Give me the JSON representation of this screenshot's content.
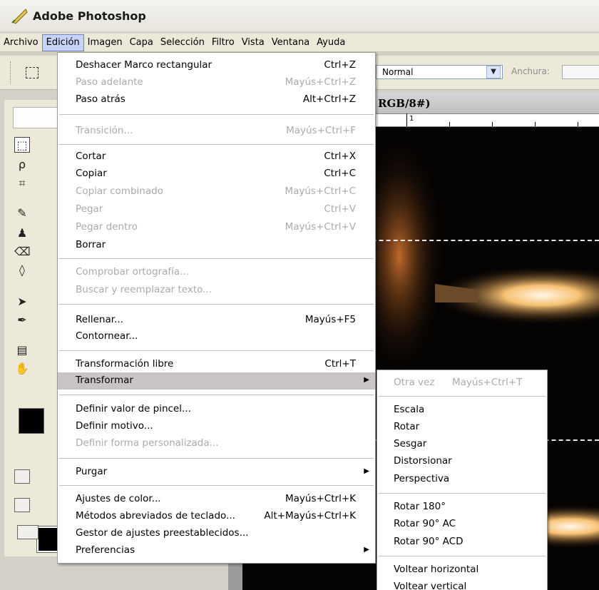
{
  "app": {
    "title": "Adobe Photoshop"
  },
  "menubar": {
    "items": [
      "Archivo",
      "Edición",
      "Imagen",
      "Capa",
      "Selección",
      "Filtro",
      "Vista",
      "Ventana",
      "Ayuda"
    ],
    "active": "Edición"
  },
  "options": {
    "mode_value": "Normal",
    "width_label": "Anchura:"
  },
  "document": {
    "title_fragment": "RGB/8#)",
    "ruler_label": "1"
  },
  "edit_menu": {
    "items": [
      {
        "label": "Deshacer Marco rectangular",
        "shortcut": "Ctrl+Z",
        "enabled": true
      },
      {
        "label": "Paso adelante",
        "shortcut": "Mayús+Ctrl+Z",
        "enabled": false
      },
      {
        "label": "Paso atrás",
        "shortcut": "Alt+Ctrl+Z",
        "enabled": true
      },
      {
        "label": "Transición...",
        "shortcut": "Mayús+Ctrl+F",
        "enabled": false
      },
      {
        "label": "Cortar",
        "shortcut": "Ctrl+X",
        "enabled": true
      },
      {
        "label": "Copiar",
        "shortcut": "Ctrl+C",
        "enabled": true
      },
      {
        "label": "Copiar combinado",
        "shortcut": "Mayús+Ctrl+C",
        "enabled": false
      },
      {
        "label": "Pegar",
        "shortcut": "Ctrl+V",
        "enabled": false
      },
      {
        "label": "Pegar dentro",
        "shortcut": "Mayús+Ctrl+V",
        "enabled": false
      },
      {
        "label": "Borrar",
        "shortcut": "",
        "enabled": true
      },
      {
        "label": "Comprobar ortografía...",
        "shortcut": "",
        "enabled": false
      },
      {
        "label": "Buscar y reemplazar texto...",
        "shortcut": "",
        "enabled": false
      },
      {
        "label": "Rellenar...",
        "shortcut": "Mayús+F5",
        "enabled": true
      },
      {
        "label": "Contornear...",
        "shortcut": "",
        "enabled": true
      },
      {
        "label": "Transformación libre",
        "shortcut": "Ctrl+T",
        "enabled": true
      },
      {
        "label": "Transformar",
        "shortcut": "",
        "enabled": true,
        "submenu": true,
        "highlighted": true
      },
      {
        "label": "Definir valor de pincel...",
        "shortcut": "",
        "enabled": true
      },
      {
        "label": "Definir motivo...",
        "shortcut": "",
        "enabled": true
      },
      {
        "label": "Definir forma personalizada...",
        "shortcut": "",
        "enabled": false
      },
      {
        "label": "Purgar",
        "shortcut": "",
        "enabled": true,
        "submenu": true
      },
      {
        "label": "Ajustes de color...",
        "shortcut": "Mayús+Ctrl+K",
        "enabled": true
      },
      {
        "label": "Métodos abreviados de teclado...",
        "shortcut": "Alt+Mayús+Ctrl+K",
        "enabled": true
      },
      {
        "label": "Gestor de ajustes preestablecidos...",
        "shortcut": "",
        "enabled": true
      },
      {
        "label": "Preferencias",
        "shortcut": "",
        "enabled": true,
        "submenu": true
      }
    ]
  },
  "transform_submenu": {
    "items": [
      {
        "label": "Otra vez",
        "shortcut": "Mayús+Ctrl+T",
        "enabled": false
      },
      {
        "label": "Escala",
        "shortcut": "",
        "enabled": true
      },
      {
        "label": "Rotar",
        "shortcut": "",
        "enabled": true
      },
      {
        "label": "Sesgar",
        "shortcut": "",
        "enabled": true
      },
      {
        "label": "Distorsionar",
        "shortcut": "",
        "enabled": true
      },
      {
        "label": "Perspectiva",
        "shortcut": "",
        "enabled": true
      },
      {
        "label": "Rotar 180°",
        "shortcut": "",
        "enabled": true
      },
      {
        "label": "Rotar 90° AC",
        "shortcut": "",
        "enabled": true
      },
      {
        "label": "Rotar 90° ACD",
        "shortcut": "",
        "enabled": true
      },
      {
        "label": "Voltear horizontal",
        "shortcut": "",
        "enabled": true
      },
      {
        "label": "Voltear vertical",
        "shortcut": "",
        "enabled": true
      }
    ]
  }
}
